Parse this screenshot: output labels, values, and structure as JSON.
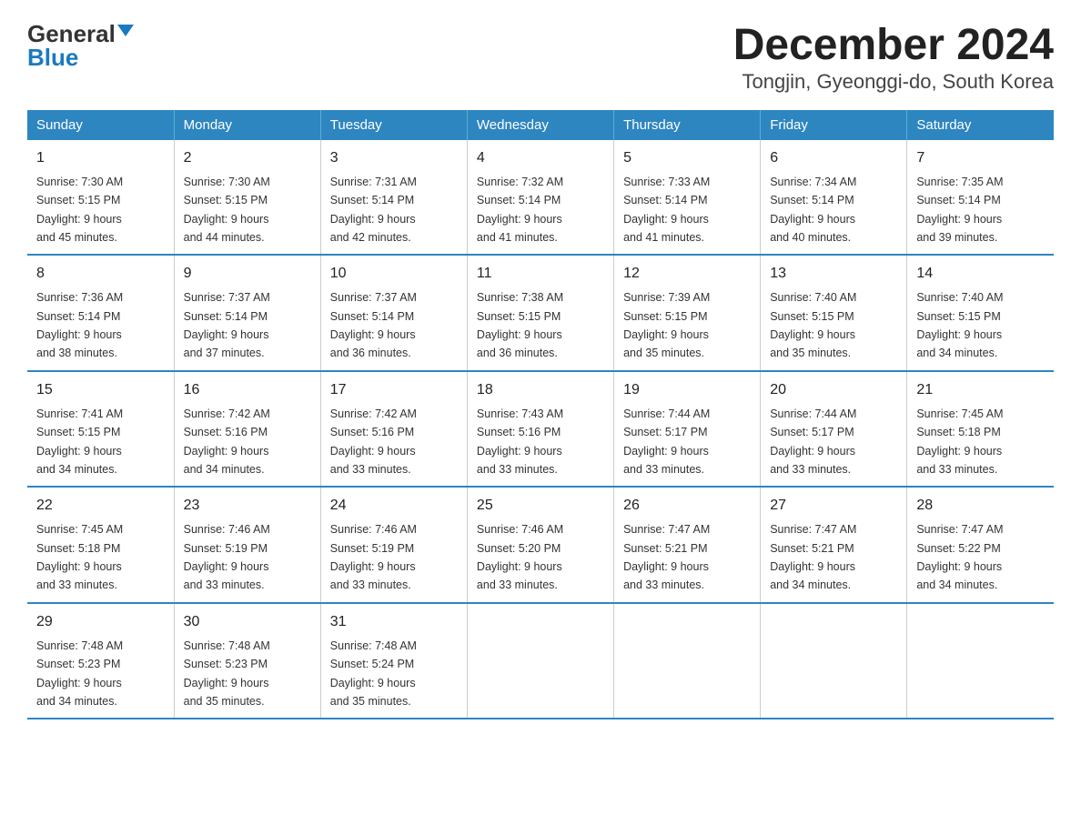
{
  "header": {
    "logo_general": "General",
    "logo_blue": "Blue",
    "title": "December 2024",
    "subtitle": "Tongjin, Gyeonggi-do, South Korea"
  },
  "days_of_week": [
    "Sunday",
    "Monday",
    "Tuesday",
    "Wednesday",
    "Thursday",
    "Friday",
    "Saturday"
  ],
  "weeks": [
    [
      {
        "day": "1",
        "sunrise": "7:30 AM",
        "sunset": "5:15 PM",
        "daylight": "9 hours and 45 minutes."
      },
      {
        "day": "2",
        "sunrise": "7:30 AM",
        "sunset": "5:15 PM",
        "daylight": "9 hours and 44 minutes."
      },
      {
        "day": "3",
        "sunrise": "7:31 AM",
        "sunset": "5:14 PM",
        "daylight": "9 hours and 42 minutes."
      },
      {
        "day": "4",
        "sunrise": "7:32 AM",
        "sunset": "5:14 PM",
        "daylight": "9 hours and 41 minutes."
      },
      {
        "day": "5",
        "sunrise": "7:33 AM",
        "sunset": "5:14 PM",
        "daylight": "9 hours and 41 minutes."
      },
      {
        "day": "6",
        "sunrise": "7:34 AM",
        "sunset": "5:14 PM",
        "daylight": "9 hours and 40 minutes."
      },
      {
        "day": "7",
        "sunrise": "7:35 AM",
        "sunset": "5:14 PM",
        "daylight": "9 hours and 39 minutes."
      }
    ],
    [
      {
        "day": "8",
        "sunrise": "7:36 AM",
        "sunset": "5:14 PM",
        "daylight": "9 hours and 38 minutes."
      },
      {
        "day": "9",
        "sunrise": "7:37 AM",
        "sunset": "5:14 PM",
        "daylight": "9 hours and 37 minutes."
      },
      {
        "day": "10",
        "sunrise": "7:37 AM",
        "sunset": "5:14 PM",
        "daylight": "9 hours and 36 minutes."
      },
      {
        "day": "11",
        "sunrise": "7:38 AM",
        "sunset": "5:15 PM",
        "daylight": "9 hours and 36 minutes."
      },
      {
        "day": "12",
        "sunrise": "7:39 AM",
        "sunset": "5:15 PM",
        "daylight": "9 hours and 35 minutes."
      },
      {
        "day": "13",
        "sunrise": "7:40 AM",
        "sunset": "5:15 PM",
        "daylight": "9 hours and 35 minutes."
      },
      {
        "day": "14",
        "sunrise": "7:40 AM",
        "sunset": "5:15 PM",
        "daylight": "9 hours and 34 minutes."
      }
    ],
    [
      {
        "day": "15",
        "sunrise": "7:41 AM",
        "sunset": "5:15 PM",
        "daylight": "9 hours and 34 minutes."
      },
      {
        "day": "16",
        "sunrise": "7:42 AM",
        "sunset": "5:16 PM",
        "daylight": "9 hours and 34 minutes."
      },
      {
        "day": "17",
        "sunrise": "7:42 AM",
        "sunset": "5:16 PM",
        "daylight": "9 hours and 33 minutes."
      },
      {
        "day": "18",
        "sunrise": "7:43 AM",
        "sunset": "5:16 PM",
        "daylight": "9 hours and 33 minutes."
      },
      {
        "day": "19",
        "sunrise": "7:44 AM",
        "sunset": "5:17 PM",
        "daylight": "9 hours and 33 minutes."
      },
      {
        "day": "20",
        "sunrise": "7:44 AM",
        "sunset": "5:17 PM",
        "daylight": "9 hours and 33 minutes."
      },
      {
        "day": "21",
        "sunrise": "7:45 AM",
        "sunset": "5:18 PM",
        "daylight": "9 hours and 33 minutes."
      }
    ],
    [
      {
        "day": "22",
        "sunrise": "7:45 AM",
        "sunset": "5:18 PM",
        "daylight": "9 hours and 33 minutes."
      },
      {
        "day": "23",
        "sunrise": "7:46 AM",
        "sunset": "5:19 PM",
        "daylight": "9 hours and 33 minutes."
      },
      {
        "day": "24",
        "sunrise": "7:46 AM",
        "sunset": "5:19 PM",
        "daylight": "9 hours and 33 minutes."
      },
      {
        "day": "25",
        "sunrise": "7:46 AM",
        "sunset": "5:20 PM",
        "daylight": "9 hours and 33 minutes."
      },
      {
        "day": "26",
        "sunrise": "7:47 AM",
        "sunset": "5:21 PM",
        "daylight": "9 hours and 33 minutes."
      },
      {
        "day": "27",
        "sunrise": "7:47 AM",
        "sunset": "5:21 PM",
        "daylight": "9 hours and 34 minutes."
      },
      {
        "day": "28",
        "sunrise": "7:47 AM",
        "sunset": "5:22 PM",
        "daylight": "9 hours and 34 minutes."
      }
    ],
    [
      {
        "day": "29",
        "sunrise": "7:48 AM",
        "sunset": "5:23 PM",
        "daylight": "9 hours and 34 minutes."
      },
      {
        "day": "30",
        "sunrise": "7:48 AM",
        "sunset": "5:23 PM",
        "daylight": "9 hours and 35 minutes."
      },
      {
        "day": "31",
        "sunrise": "7:48 AM",
        "sunset": "5:24 PM",
        "daylight": "9 hours and 35 minutes."
      },
      null,
      null,
      null,
      null
    ]
  ],
  "labels": {
    "sunrise": "Sunrise:",
    "sunset": "Sunset:",
    "daylight": "Daylight:"
  }
}
